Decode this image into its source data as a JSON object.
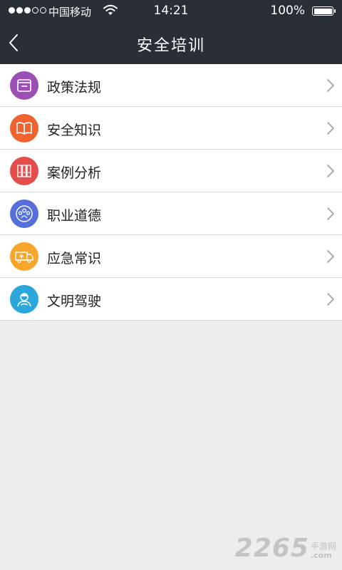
{
  "status_bar": {
    "carrier": "中国移动",
    "time": "14:21",
    "battery_percent": "100%",
    "signal_bars_filled": 3,
    "signal_bars_total": 5
  },
  "nav": {
    "title": "安全培训",
    "back_icon": "chevron-left-icon"
  },
  "menu": {
    "items": [
      {
        "label": "政策法规",
        "icon": "policy-document-icon",
        "color": "#9b4fb5"
      },
      {
        "label": "安全知识",
        "icon": "open-book-icon",
        "color": "#f0632e"
      },
      {
        "label": "案例分析",
        "icon": "binders-icon",
        "color": "#e54d4d"
      },
      {
        "label": "职业道德",
        "icon": "people-group-icon",
        "color": "#5670db"
      },
      {
        "label": "应急常识",
        "icon": "ambulance-icon",
        "color": "#f7a52b"
      },
      {
        "label": "文明驾驶",
        "icon": "driver-icon",
        "color": "#2ba7db"
      }
    ]
  },
  "watermark": {
    "number": "2265",
    "text": "手游网",
    "suffix": ".com"
  },
  "colors": {
    "header_bg": "#2a2e37",
    "page_bg": "#ededed",
    "divider": "#dcdcdc"
  }
}
